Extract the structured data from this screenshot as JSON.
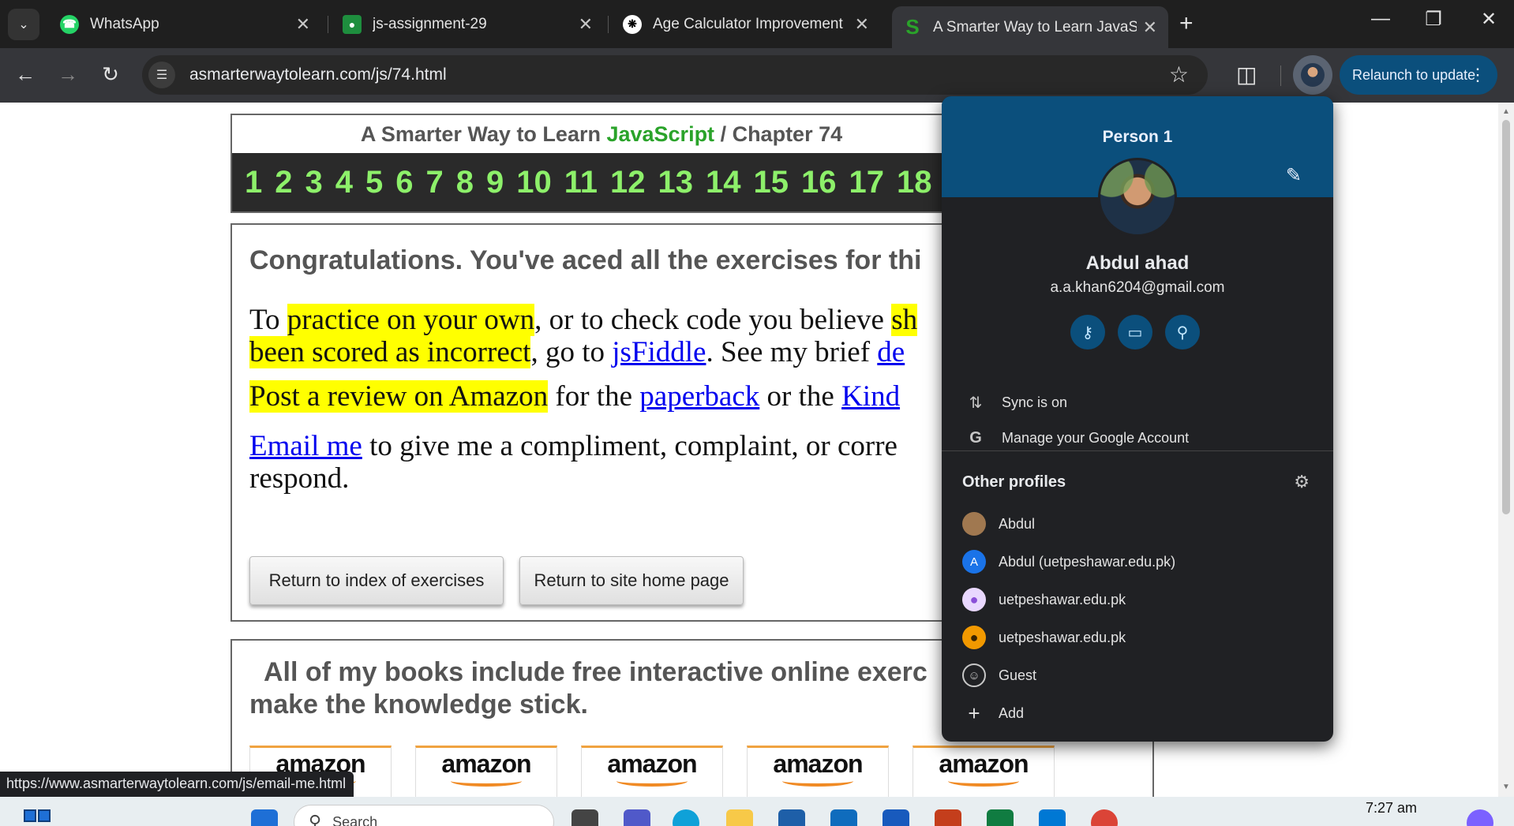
{
  "tabs": [
    {
      "title": "WhatsApp",
      "favicon": "whatsapp-icon",
      "color": "#25d366"
    },
    {
      "title": "js-assignment-29",
      "favicon": "classroom-icon",
      "color": "#1e8e3e"
    },
    {
      "title": "Age Calculator Improvement",
      "favicon": "chatgpt-icon",
      "color": "#ffffff"
    },
    {
      "title": "A Smarter Way to Learn JavaScr",
      "favicon": "asmarterway-icon",
      "color": "#2aa32a"
    }
  ],
  "toolbar": {
    "url": "asmarterwaytolearn.com/js/74.html",
    "relaunch_label": "Relaunch to update"
  },
  "page": {
    "site_title_prefix": "A Smarter Way to Learn ",
    "site_title_js": "JavaScript",
    "site_title_suffix": " / Chapter 74",
    "chapters": [
      "1",
      "2",
      "3",
      "4",
      "5",
      "6",
      "7",
      "8",
      "9",
      "10",
      "11",
      "12",
      "13",
      "14",
      "15",
      "16",
      "17",
      "18"
    ],
    "congrats": "Congratulations. You've aced all the exercises for thi",
    "p1": {
      "t1": "To ",
      "h1": "practice on your own",
      "t2": ", or to check code you believe ",
      "h2": "sh",
      "h3": "been scored as incorrect",
      "t3": ", go to ",
      "link1": "jsFiddle",
      "t4": ". See my brief ",
      "link2": "de"
    },
    "p2": {
      "h1": "Post a review on Amazon",
      "t1": " for the ",
      "link1": "paperback",
      "t2": " or the ",
      "link2": "Kind"
    },
    "p3": {
      "link1": "Email me",
      "t1": " to give me a compliment, complaint, or corre",
      "t2": "respond."
    },
    "btn_index": "Return to index of exercises",
    "btn_home": "Return to site home page",
    "books_line1": "All of my books include free interactive online exerc",
    "books_line2": "make the knowledge stick.",
    "amazon_label": "amazon"
  },
  "status_url": "https://www.asmarterwaytolearn.com/js/email-me.html",
  "profile": {
    "header": "Person 1",
    "name": "Abdul ahad",
    "email": "a.a.khan6204@gmail.com",
    "sync": "Sync is on",
    "manage": "Manage your Google Account",
    "other_title": "Other profiles",
    "others": [
      {
        "name": "Abdul",
        "avatar": "photo",
        "color": "#a07850"
      },
      {
        "name": "Abdul (uetpeshawar.edu.pk)",
        "avatar": "A",
        "color": "#1a73e8"
      },
      {
        "name": "uetpeshawar.edu.pk",
        "avatar": "person",
        "color": "#8a4fd8"
      },
      {
        "name": "uetpeshawar.edu.pk",
        "avatar": "person",
        "color": "#f29900"
      },
      {
        "name": "Guest",
        "avatar": "guest",
        "color": "#202124"
      },
      {
        "name": "Add",
        "avatar": "plus",
        "color": "#202124"
      }
    ]
  },
  "taskbar": {
    "search_placeholder": "Search",
    "time": "7:27 am"
  }
}
